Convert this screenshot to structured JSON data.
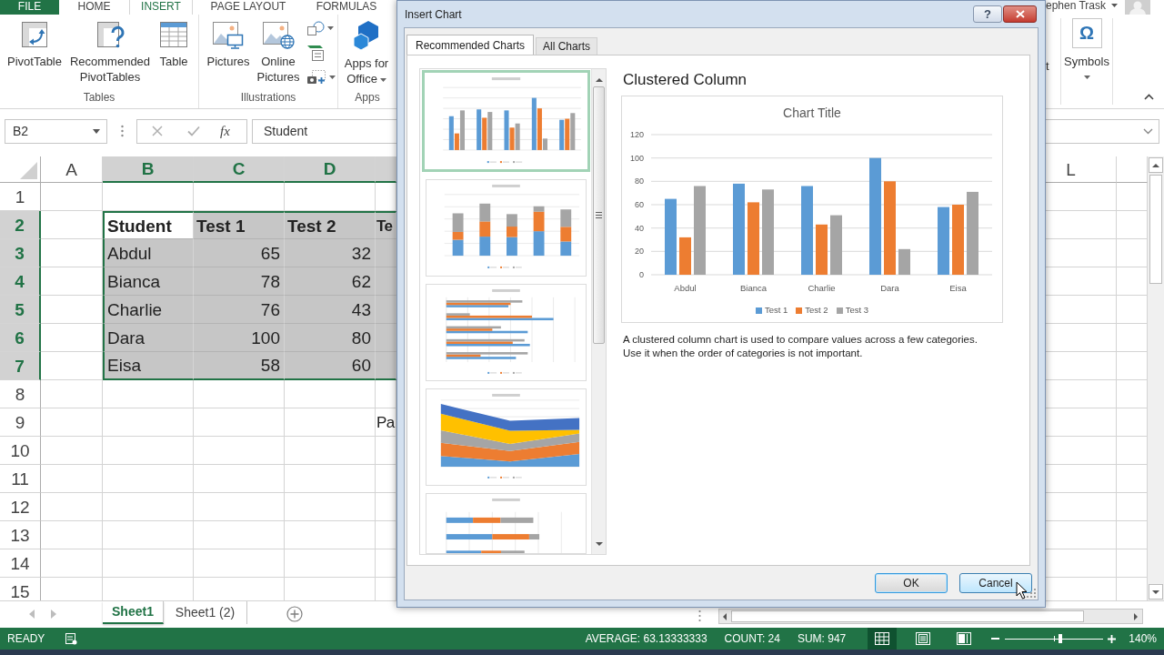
{
  "ribbon": {
    "tabs": [
      {
        "label": "FILE",
        "kind": "file",
        "selected": false
      },
      {
        "label": "HOME",
        "kind": "tab",
        "selected": false
      },
      {
        "label": "INSERT",
        "kind": "tab",
        "selected": true
      },
      {
        "label": "PAGE LAYOUT",
        "kind": "tab",
        "selected": false
      },
      {
        "label": "FORMULAS",
        "kind": "tab",
        "selected": false
      }
    ],
    "account": {
      "name": "ephen Trask"
    },
    "groups": [
      {
        "label": "Tables",
        "commands": [
          {
            "label": "PivotTable",
            "dropdown": false
          },
          {
            "label": "Recommended PivotTables",
            "dropdown": false
          },
          {
            "label": "Table",
            "dropdown": false
          }
        ]
      },
      {
        "label": "Illustrations",
        "commands": [
          {
            "label": "Pictures",
            "dropdown": false
          },
          {
            "label": "Online Pictures",
            "dropdown": false
          }
        ],
        "small_commands": [
          {
            "dropdown": true
          },
          {
            "dropdown": false
          },
          {
            "dropdown": true
          }
        ]
      },
      {
        "label": "Apps",
        "commands": [
          {
            "label": "Apps for Office",
            "dropdown": true
          }
        ]
      }
    ],
    "cut_label": "t",
    "symbols": {
      "glyph": "Ω",
      "label": "Symbols",
      "dropdown": true
    }
  },
  "formula_bar": {
    "name_box": "B2",
    "function_label": "fx",
    "formula": "Student"
  },
  "sheet": {
    "columns": [
      {
        "label": "A",
        "selected": false
      },
      {
        "label": "B",
        "selected": true
      },
      {
        "label": "C",
        "selected": true
      },
      {
        "label": "D",
        "selected": true
      }
    ],
    "far_columns": [
      {
        "label": "L",
        "selected": false
      }
    ],
    "rows": [
      {
        "label": "1",
        "selected": false
      },
      {
        "label": "2",
        "selected": true,
        "cells": [
          null,
          {
            "text": "Student",
            "kind": "header",
            "selected": true,
            "active": true
          },
          {
            "text": "Test 1",
            "kind": "header",
            "selected": true,
            "active": false
          },
          {
            "text": "Test 2",
            "kind": "header",
            "selected": true,
            "active": false
          },
          {
            "text": "Te",
            "kind": "header",
            "selected": true,
            "active": false
          }
        ]
      },
      {
        "label": "3",
        "selected": true,
        "cells": [
          null,
          {
            "text": "Abdul",
            "kind": "text",
            "selected": true,
            "active": false
          },
          {
            "text": "65",
            "kind": "number",
            "selected": true,
            "active": false
          },
          {
            "text": "32",
            "kind": "number",
            "selected": true,
            "active": false
          },
          {
            "kind": "number",
            "selected": true,
            "active": false
          }
        ]
      },
      {
        "label": "4",
        "selected": true,
        "cells": [
          null,
          {
            "text": "Bianca",
            "kind": "text",
            "selected": true,
            "active": false
          },
          {
            "text": "78",
            "kind": "number",
            "selected": true,
            "active": false
          },
          {
            "text": "62",
            "kind": "number",
            "selected": true,
            "active": false
          },
          {
            "kind": "number",
            "selected": true,
            "active": false
          }
        ]
      },
      {
        "label": "5",
        "selected": true,
        "cells": [
          null,
          {
            "text": "Charlie",
            "kind": "text",
            "selected": true,
            "active": false
          },
          {
            "text": "76",
            "kind": "number",
            "selected": true,
            "active": false
          },
          {
            "text": "43",
            "kind": "number",
            "selected": true,
            "active": false
          },
          {
            "kind": "number",
            "selected": true,
            "active": false
          }
        ]
      },
      {
        "label": "6",
        "selected": true,
        "cells": [
          null,
          {
            "text": "Dara",
            "kind": "text",
            "selected": true,
            "active": false
          },
          {
            "text": "100",
            "kind": "number",
            "selected": true,
            "active": false
          },
          {
            "text": "80",
            "kind": "number",
            "selected": true,
            "active": false
          },
          {
            "kind": "number",
            "selected": true,
            "active": false
          }
        ]
      },
      {
        "label": "7",
        "selected": true,
        "cells": [
          null,
          {
            "text": "Eisa",
            "kind": "text",
            "selected": true,
            "active": false
          },
          {
            "text": "58",
            "kind": "number",
            "selected": true,
            "active": false
          },
          {
            "text": "60",
            "kind": "number",
            "selected": true,
            "active": false
          },
          {
            "kind": "number",
            "selected": true,
            "active": false
          }
        ]
      },
      {
        "label": "8",
        "selected": false
      },
      {
        "label": "9",
        "selected": false,
        "cells": [
          null,
          null,
          null,
          null,
          {
            "text": "Pa",
            "kind": "text",
            "selected": false,
            "active": false
          }
        ]
      },
      {
        "label": "10",
        "selected": false
      },
      {
        "label": "11",
        "selected": false
      },
      {
        "label": "12",
        "selected": false
      },
      {
        "label": "13",
        "selected": false
      },
      {
        "label": "14",
        "selected": false
      },
      {
        "label": "15",
        "selected": false
      }
    ]
  },
  "sheet_tabs": [
    {
      "label": "Sheet1",
      "selected": true
    },
    {
      "label": "Sheet1 (2)",
      "selected": false
    }
  ],
  "status_bar": {
    "mode": "READY",
    "stats": [
      "AVERAGE: 63.13333333",
      "COUNT: 24",
      "SUM: 947"
    ],
    "views": [
      {
        "selected": true
      },
      {
        "selected": false
      },
      {
        "selected": false
      }
    ],
    "zoom": {
      "level": 0.56,
      "label": "140%"
    }
  },
  "dialog": {
    "title": "Insert Chart",
    "help": "?",
    "tabs": [
      {
        "label": "Recommended Charts",
        "selected": true
      },
      {
        "label": "All Charts",
        "selected": false
      }
    ],
    "thumbnails": [
      {
        "kind": "clustered_column",
        "selected": true
      },
      {
        "kind": "stacked_column",
        "selected": false
      },
      {
        "kind": "clustered_bar",
        "selected": false
      },
      {
        "kind": "stacked_area",
        "selected": false
      },
      {
        "kind": "stacked_bar",
        "selected": false
      }
    ],
    "preview": {
      "heading": "Clustered Column",
      "chart_data": {
        "type": "bar",
        "title": "Chart Title",
        "categories": [
          "Abdul",
          "Bianca",
          "Charlie",
          "Dara",
          "Eisa"
        ],
        "series": [
          {
            "name": "Test 1",
            "color": "#5b9bd5",
            "values": [
              65,
              78,
              76,
              100,
              58
            ]
          },
          {
            "name": "Test 2",
            "color": "#ed7d31",
            "values": [
              32,
              62,
              43,
              80,
              60
            ]
          },
          {
            "name": "Test 3",
            "color": "#a5a5a5",
            "values": [
              76,
              73,
              51,
              22,
              71
            ]
          }
        ],
        "ylim": [
          0,
          120
        ],
        "yticks": [
          0,
          20,
          40,
          60,
          80,
          100,
          120
        ],
        "grid": true,
        "legend": "bottom"
      },
      "description": [
        "A clustered column chart is used to compare values across a few categories.",
        "Use it when the order of categories is not important."
      ]
    },
    "buttons": [
      {
        "label": "OK",
        "default": true,
        "hovered": false
      },
      {
        "label": "Cancel",
        "default": false,
        "hovered": true
      }
    ]
  }
}
